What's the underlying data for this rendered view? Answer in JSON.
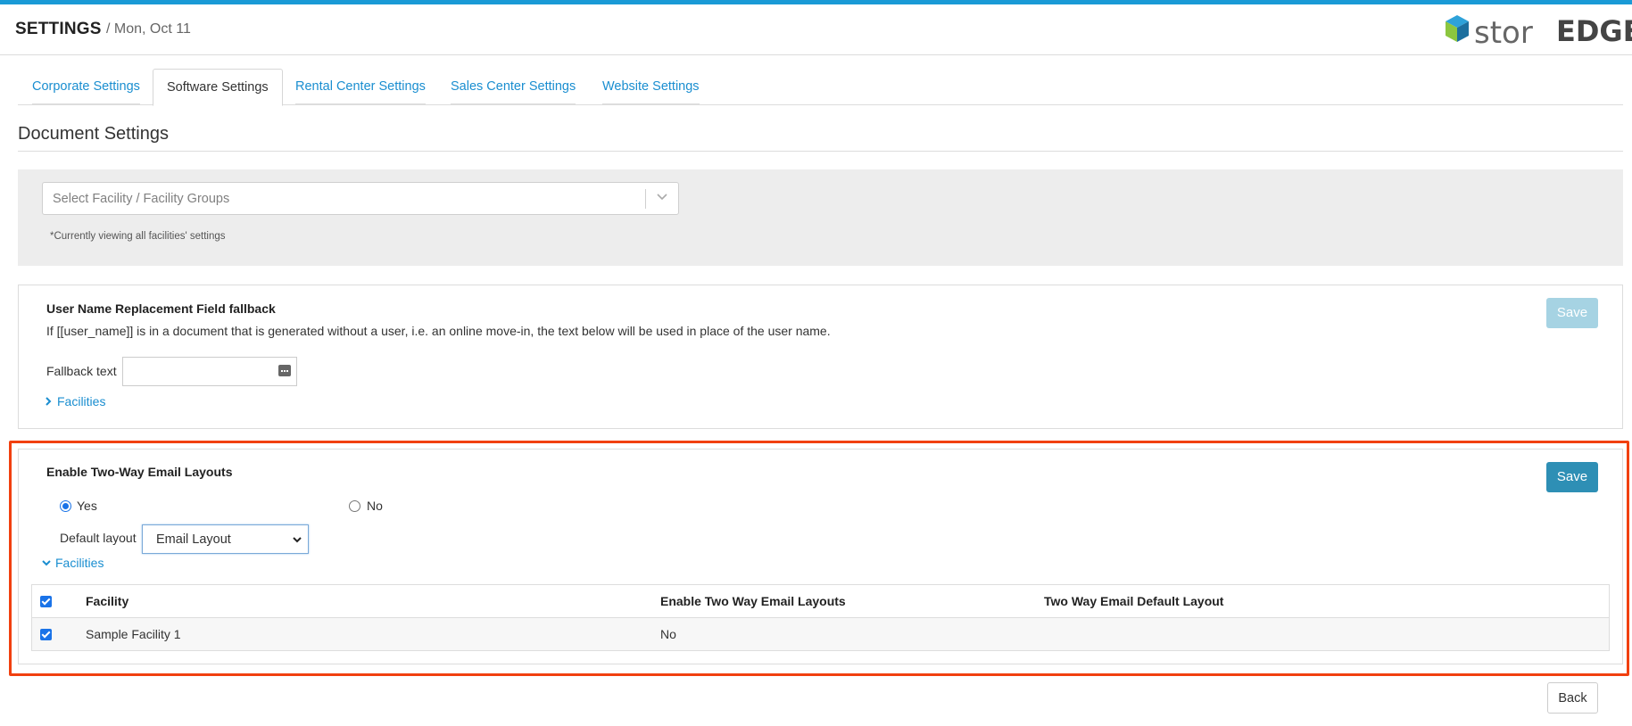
{
  "header": {
    "title": "SETTINGS",
    "date": "/ Mon, Oct 11",
    "logo_part1": "stor",
    "logo_part2": "EDGE"
  },
  "tabs": [
    {
      "label": "Corporate Settings",
      "active": false
    },
    {
      "label": "Software Settings",
      "active": true
    },
    {
      "label": "Rental Center Settings",
      "active": false
    },
    {
      "label": "Sales Center Settings",
      "active": false
    },
    {
      "label": "Website Settings",
      "active": false
    }
  ],
  "section": {
    "title": "Document Settings"
  },
  "filter": {
    "placeholder": "Select Facility / Facility Groups",
    "note": "*Currently viewing all facilities' settings"
  },
  "username_panel": {
    "title": "User Name Replacement Field fallback",
    "description": "If [[user_name]] is in a document that is generated without a user, i.e. an online move-in, the text below will be used in place of the user name.",
    "fallback_label": "Fallback text",
    "fallback_value": "",
    "facilities_label": "Facilities",
    "save_label": "Save",
    "save_enabled": false
  },
  "email_panel": {
    "title": "Enable Two-Way Email Layouts",
    "yes_label": "Yes",
    "no_label": "No",
    "selected": "Yes",
    "default_layout_label": "Default layout",
    "default_layout_value": "Email Layout",
    "facilities_label": "Facilities",
    "save_label": "Save",
    "save_enabled": true,
    "table": {
      "headers": [
        "Facility",
        "Enable Two Way Email Layouts",
        "Two Way Email Default Layout"
      ],
      "rows": [
        {
          "checked": true,
          "facility": "Sample Facility 1",
          "enable": "No",
          "default_layout": ""
        }
      ]
    }
  },
  "footer": {
    "back_label": "Back"
  },
  "colors": {
    "accent": "#1a9ad6",
    "link": "#1a8ed0",
    "save_enabled": "#2e8fb5",
    "save_disabled": "#a6d3e3",
    "highlight_border": "#f1400f"
  }
}
